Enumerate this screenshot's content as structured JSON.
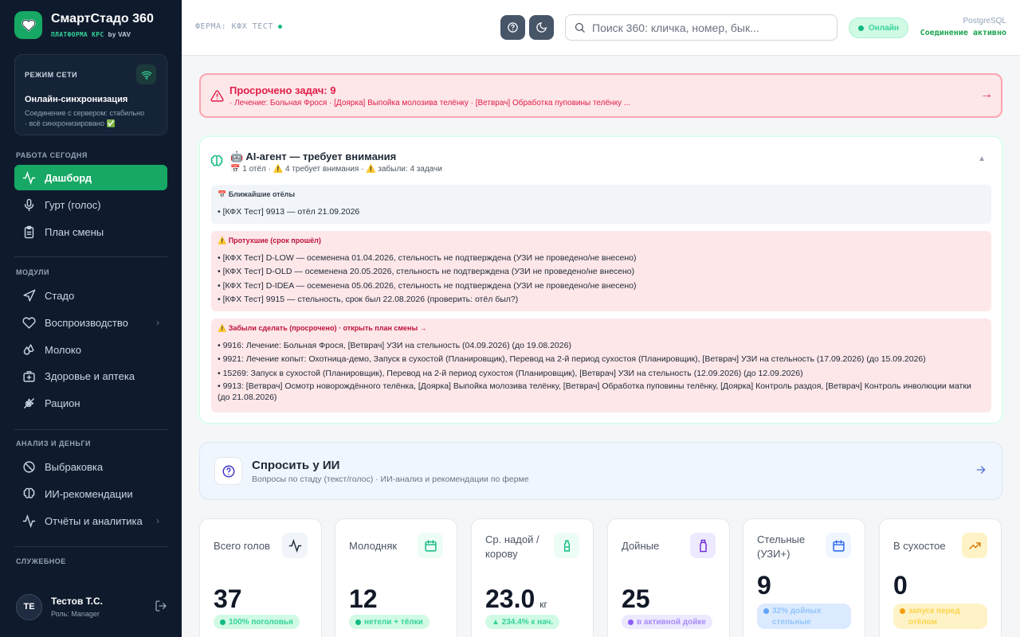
{
  "brand": {
    "title": "СмартСтадо 360",
    "platform": "ПЛАТФОРМА КРС",
    "by": "by VAV",
    "icon": "heart-icon"
  },
  "network": {
    "label": "РЕЖИМ СЕТИ",
    "title": "Онлайн-синхронизация",
    "desc1": "Соединение с сервером: стабильно",
    "desc2": "· всё синхронизировано ✅"
  },
  "sidebar": {
    "sections": {
      "today": "РАБОТА СЕГОДНЯ",
      "modules": "МОДУЛИ",
      "analysis": "АНАЛИЗ И ДЕНЬГИ",
      "service": "СЛУЖЕБНОЕ"
    },
    "items": [
      {
        "label": "Дашборд",
        "icon": "activity-icon"
      },
      {
        "label": "Гурт (голос)",
        "icon": "mic-icon"
      },
      {
        "label": "План смены",
        "icon": "clipboard-icon"
      },
      {
        "label": "Стадо",
        "icon": "navigation-icon"
      },
      {
        "label": "Воспроизводство",
        "icon": "heart-icon"
      },
      {
        "label": "Молоко",
        "icon": "droplets-icon"
      },
      {
        "label": "Здоровье и аптека",
        "icon": "briefcase-medical-icon"
      },
      {
        "label": "Рацион",
        "icon": "wheat-icon"
      },
      {
        "label": "Выбраковка",
        "icon": "ban-icon"
      },
      {
        "label": "ИИ-рекомендации",
        "icon": "brain-icon"
      },
      {
        "label": "Отчёты и аналитика",
        "icon": "activity-icon"
      }
    ]
  },
  "user": {
    "initials": "ТЕ",
    "name": "Тестов Т.С.",
    "role": "Роль: Manager"
  },
  "topbar": {
    "farm": "ФЕРМА: КФХ ТЕСТ",
    "search_placeholder": "Поиск 360: кличка, номер, бык...",
    "online": "Онлайн",
    "db_name": "PostgreSQL",
    "db_status": "Соединение активно"
  },
  "alert": {
    "title": "Просрочено задач: 9",
    "sub": "· Лечение: Больная Фрося · [Доярка] Выпойка молозива телёнку · [Ветврач] Обработка пуповины телёнку ..."
  },
  "ai": {
    "title": "🤖 AI-агент — требует внимания",
    "sub": "📅 1 отёл · ⚠️ 4 требует внимания · ⚠️ забыли: 4 задачи",
    "calving": {
      "head": "📅 Ближайшие отёлы",
      "lines": [
        "• [КФХ Тест] 9913 — отёл 21.09.2026"
      ]
    },
    "expired": {
      "head": "⚠️ Протухшие (срок прошёл)",
      "lines": [
        "• [КФХ Тест] D-LOW — осеменена 01.04.2026, стельность не подтверждена (УЗИ не проведено/не внесено)",
        "• [КФХ Тест] D-OLD — осеменена 20.05.2026, стельность не подтверждена (УЗИ не проведено/не внесено)",
        "• [КФХ Тест] D-IDEA — осеменена 05.06.2026, стельность не подтверждена (УЗИ не проведено/не внесено)",
        "• [КФХ Тест] 9915 — стельность, срок был 22.08.2026 (проверить: отёл был?)"
      ]
    },
    "forgot": {
      "head": "⚠️ Забыли сделать (просрочено) · открыть план смены →",
      "lines": [
        "• 9916: Лечение: Больная Фрося, [Ветврач] УЗИ на стельность (04.09.2026) (до 19.08.2026)",
        "• 9921: Лечение копыт: Охотница-демо, Запуск в сухостой (Планировщик), Перевод на 2-й период сухостоя (Планировщик), [Ветврач] УЗИ на стельность (17.09.2026) (до 15.09.2026)",
        "• 15269: Запуск в сухостой (Планировщик), Перевод на 2-й период сухостоя (Планировщик), [Ветврач] УЗИ на стельность (12.09.2026) (до 12.09.2026)",
        "• 9913: [Ветврач] Осмотр новорождённого телёнка, [Доярка] Выпойка молозива телёнку, [Ветврач] Обработка пуповины телёнку, [Доярка] Контроль раздоя, [Ветврач] Контроль инволюции матки (до 21.08.2026)"
      ]
    }
  },
  "ask": {
    "title": "Спросить у ИИ",
    "sub": "Вопросы по стаду (текст/голос) · ИИ-анализ и рекомендации по ферме"
  },
  "stats": [
    {
      "label": "Всего голов",
      "value": "37",
      "unit": "",
      "chip": "100% поголовья",
      "icon": "activity-icon",
      "color": "#10b981"
    },
    {
      "label": "Молодняк",
      "value": "12",
      "unit": "",
      "chip": "нетели + тёлки",
      "icon": "calendar-icon",
      "color": "#10b981"
    },
    {
      "label": "Ср. надой / корову",
      "value": "23.0",
      "unit": "кг",
      "chip": "▲ 234.4% к нач.",
      "icon": "milk-icon",
      "color": "#10b981"
    },
    {
      "label": "Дойные",
      "value": "25",
      "unit": "",
      "chip": "в активной дойке",
      "icon": "milk-bottle-icon",
      "color": "#8b5cf6"
    },
    {
      "label": "Стельные (УЗИ+)",
      "value": "9",
      "unit": "",
      "chip": "32% дойных стельные",
      "icon": "calendar-icon",
      "color": "#3b82f6"
    },
    {
      "label": "В сухостое",
      "value": "0",
      "unit": "",
      "chip": "запуск перед отёлом",
      "icon": "trending-up-icon",
      "color": "#f59e0b"
    }
  ]
}
